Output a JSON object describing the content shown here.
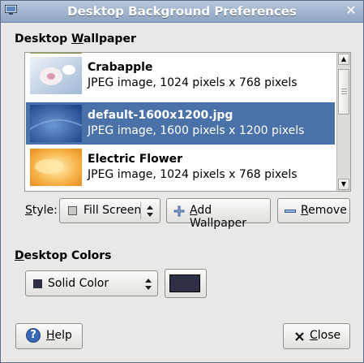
{
  "window": {
    "title": "Desktop Background Preferences"
  },
  "wallpaper_section": {
    "prefix": "Desktop ",
    "mnemonic": "W",
    "suffix": "allpaper"
  },
  "wallpapers": [
    {
      "name": "Crabapple",
      "description": "JPEG image, 1024 pixels x 768 pixels"
    },
    {
      "name": "default-1600x1200.jpg",
      "description": "JPEG image, 1600 pixels x 1200 pixels",
      "selected": true
    },
    {
      "name": "Electric Flower",
      "description": "JPEG image, 1024 pixels x 768 pixels"
    }
  ],
  "style": {
    "label_mnemonic": "S",
    "label_rest": "tyle:",
    "value": "Fill Screen"
  },
  "buttons": {
    "add": {
      "mnemonic": "A",
      "rest": "dd Wallpaper"
    },
    "remove": {
      "mnemonic": "R",
      "rest": "emove"
    },
    "help": {
      "mnemonic": "H",
      "rest": "elp"
    },
    "close": {
      "mnemonic": "C",
      "rest": "lose"
    }
  },
  "colors_section": {
    "mnemonic": "D",
    "rest": "esktop Colors"
  },
  "color_mode": {
    "value": "Solid Color"
  },
  "color": {
    "primary": "#2d2f45"
  },
  "theme": {
    "selection": "#4a72a8",
    "titlebar": "#9fb3cc"
  }
}
